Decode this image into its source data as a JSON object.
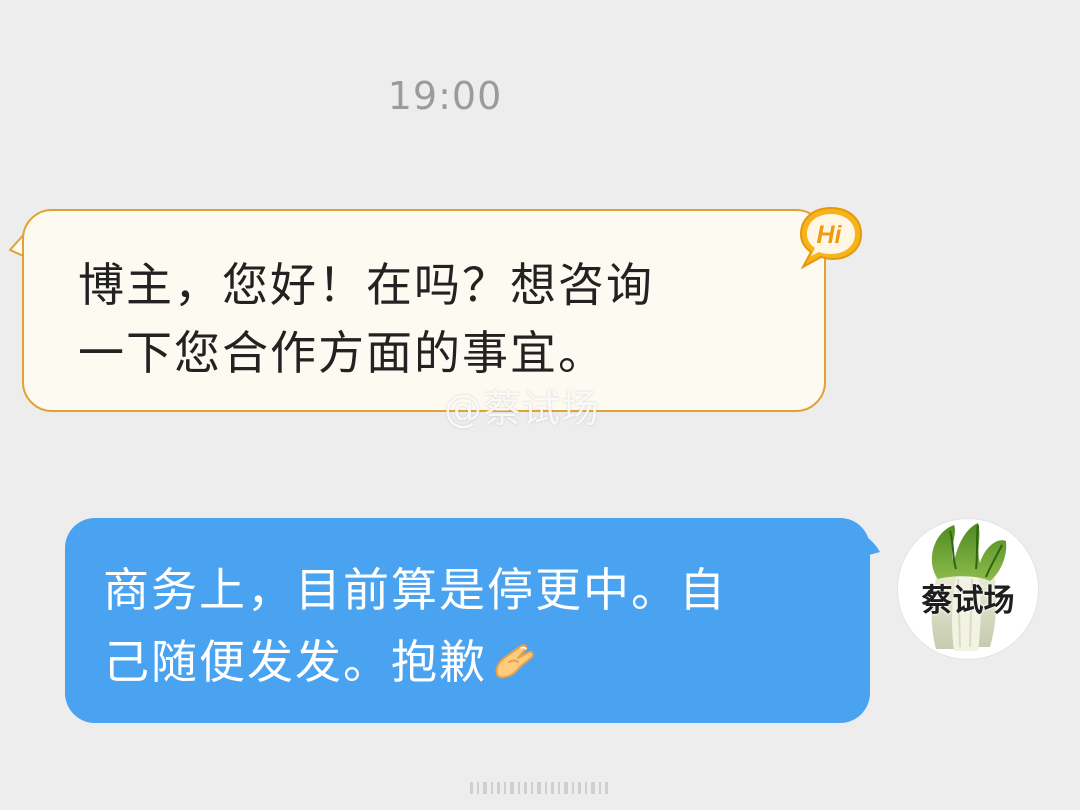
{
  "conversation": {
    "timestamp": "19:00",
    "messages": [
      {
        "direction": "incoming",
        "lines": [
          "博主，您好！在吗？想咨询",
          "一下您合作方面的事宜。"
        ],
        "bubble_color": "#fdfaf1",
        "border_color": "#e2a233",
        "badge_label": "Hi",
        "badge_icon": "hi-speech-badge-icon"
      },
      {
        "direction": "outgoing",
        "lines": [
          "商务上，目前算是停更中。自",
          "己随便发发。抱歉"
        ],
        "emoji": "pinched-hand-emoji-icon",
        "bubble_color": "#4aa3f1",
        "avatar_label": "蔡试场",
        "avatar_icon": "napa-cabbage-icon"
      }
    ]
  },
  "watermark": {
    "text": "@蔡试场"
  }
}
